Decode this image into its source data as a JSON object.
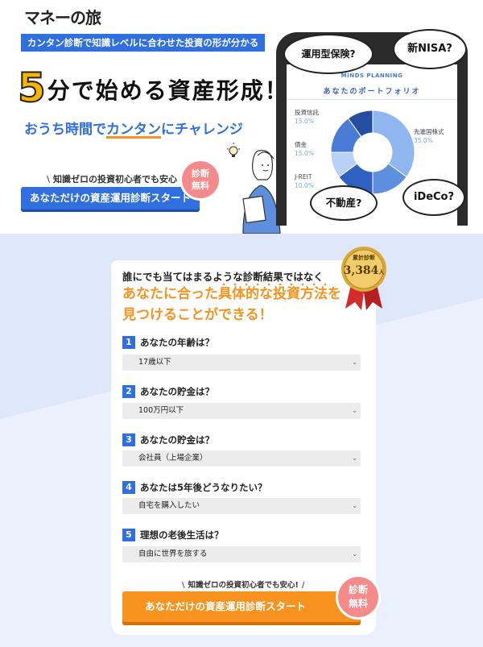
{
  "logo": {
    "text": "マネーの旅"
  },
  "hero": {
    "banner": "カンタン診断で知識レベルに合わせた投資の形が分かる",
    "headline_num": "5",
    "headline_text": "分で始める資産形成！",
    "sub_pre": "おうち時間で",
    "sub_hl": "カンタン",
    "sub_post": "にチャレンジ",
    "cta_note": "知識ゼロの投資初心者でも安心",
    "cta_label": "あなただけの資産運用診断スタート",
    "badge_line1": "診断",
    "badge_line2": "無料"
  },
  "phone": {
    "brand": "MINDS PLANNING",
    "title": "あなたのポートフォリオ",
    "legend": [
      {
        "name": "投資信託",
        "pct": "15.0%"
      },
      {
        "name": "債金",
        "pct": "15.0%"
      },
      {
        "name": "J-REIT",
        "pct": "10.0%"
      },
      {
        "name": "先進国株式",
        "pct": "35.0%"
      }
    ],
    "donut_colors": [
      "#8fb6ef",
      "#5e8ede",
      "#2f62c0",
      "#b9d1f5",
      "#4a7bd6",
      "#254f9e"
    ],
    "donut_shares": [
      0.35,
      0.15,
      0.15,
      0.1,
      0.15,
      0.1
    ]
  },
  "bubbles": {
    "b1": "運用型保険?",
    "b2": "新NISA?",
    "b3": "不動産?",
    "b4": "iDeCo?"
  },
  "card": {
    "head": "誰にでも当てはまるような診断結果ではなく",
    "big_line1_a": "あなたに合った",
    "big_line1_b": "具体的な投資方法",
    "big_line1_c": "を",
    "big_line2": "見つけることができる！",
    "medal_line1": "累計診断",
    "medal_num": "3,384",
    "medal_unit": "人"
  },
  "questions": [
    {
      "num": "1",
      "label": "あなたの年齢は？",
      "value": "17歳以下"
    },
    {
      "num": "2",
      "label": "あなたの貯金は？",
      "value": "100万円以下"
    },
    {
      "num": "3",
      "label": "あなたの貯金は？",
      "value": "会社員（上場企業）"
    },
    {
      "num": "4",
      "label": "あなたは5年後どうなりたい？",
      "value": "自宅を購入したい"
    },
    {
      "num": "5",
      "label": "理想の老後生活は？",
      "value": "自由に世界を旅する"
    }
  ],
  "cta2": {
    "note": "知識ゼロの投資初心者でも安心!",
    "label": "あなただけの資産運用診断スタート",
    "badge_line1": "診断",
    "badge_line2": "無料"
  },
  "colors": {
    "brand_blue": "#2f6fde",
    "accent_orange": "#f7931e",
    "badge_pink": "#f58a8a",
    "bg_light_blue": "#dfe8fb"
  }
}
